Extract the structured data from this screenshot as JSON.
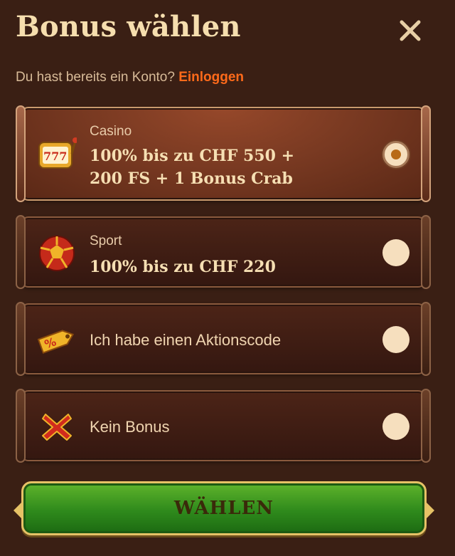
{
  "header": {
    "title": "Bonus wählen"
  },
  "account": {
    "prompt": "Du hast bereits ein Konto?",
    "login_link": "Einloggen"
  },
  "options": [
    {
      "label": "Casino",
      "value_line1": "100% bis zu CHF 550 +",
      "value_line2": "200 FS + 1 Bonus Crab",
      "icon": "slot-machine-icon",
      "selected": true
    },
    {
      "label": "Sport",
      "value_line1": "100% bis zu CHF 220",
      "icon": "soccer-ball-icon",
      "selected": false
    },
    {
      "text": "Ich habe einen Aktionscode",
      "icon": "promo-tag-icon",
      "selected": false
    },
    {
      "text": "Kein Bonus",
      "icon": "red-x-icon",
      "selected": false
    }
  ],
  "cta": {
    "label": "WÄHLEN"
  },
  "colors": {
    "background": "#3a1f14",
    "title": "#f6deae",
    "link": "#ff6a1a",
    "cta_green": "#2f8a1c",
    "cta_border": "#e6c266"
  }
}
